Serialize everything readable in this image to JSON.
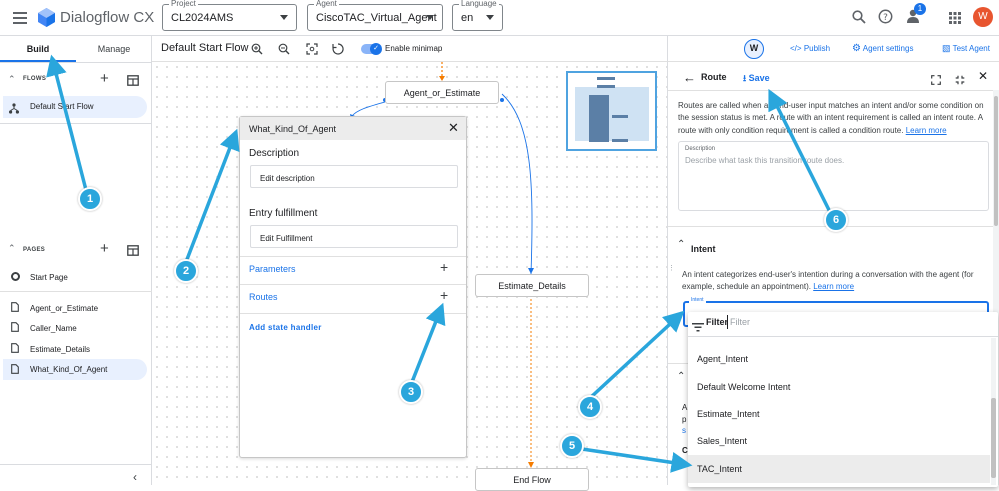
{
  "topbar": {
    "app_title": "Dialogflow CX",
    "project_label": "Project",
    "project_value": "CL2024AMS",
    "agent_label": "Agent",
    "agent_value": "CiscoTAC_Virtual_Agent",
    "language_label": "Language",
    "language_value": "en",
    "notif_count": "1",
    "avatar_letter": "W"
  },
  "left": {
    "tabs": [
      "Build",
      "Manage"
    ],
    "flows_header": "FLOWS",
    "flows": [
      "Default Start Flow"
    ],
    "pages_header": "PAGES",
    "pages": [
      "Start Page",
      "Agent_or_Estimate",
      "Caller_Name",
      "Estimate_Details",
      "What_Kind_Of_Agent"
    ]
  },
  "canvas_toolbar": {
    "flow_title": "Default Start Flow",
    "minimap_label": "Enable minimap",
    "user_chip": "W",
    "publish": "Publish",
    "agent_settings": "Agent settings",
    "test_agent": "Test Agent"
  },
  "canvas": {
    "nodes": [
      "Agent_or_Estimate",
      "Estimate_Details",
      "End Flow"
    ],
    "card": {
      "title": "What_Kind_Of_Agent",
      "description_heading": "Description",
      "description_btn": "Edit description",
      "entry_heading": "Entry fulfillment",
      "entry_btn": "Edit Fulfillment",
      "parameters": "Parameters",
      "routes": "Routes",
      "add_state": "Add state handler"
    }
  },
  "route": {
    "title": "Route",
    "save": "Save",
    "intro": "Routes are called when an end-user input matches an intent and/or some condition on the session status is met. A route with an intent requirement is called an intent route. A route with only condition requirement is called a condition route.",
    "learn_more": "Learn more",
    "desc_label": "Description",
    "desc_placeholder": "Describe what task this transition route does.",
    "intent_heading": "Intent",
    "intent_text": "An intent categorizes end-user's intention during a conversation with the agent (for example, schedule an appointment).",
    "intent_learn": "Learn more",
    "intent_field_label": "Intent",
    "filter_label": "Filter",
    "filter_placeholder": "Filter",
    "options": [
      "Agent_Intent",
      "Default Welcome Intent",
      "Estimate_Intent",
      "Sales_Intent",
      "TAC_Intent"
    ],
    "partial_letters": [
      "A",
      "p",
      "s",
      "C"
    ]
  },
  "badges": [
    "1",
    "2",
    "3",
    "4",
    "5",
    "6"
  ],
  "colors": {
    "accent": "#1a73e8",
    "badge": "#2aa6dc",
    "orange": "#f57c00",
    "avatar": "#e8552f"
  }
}
